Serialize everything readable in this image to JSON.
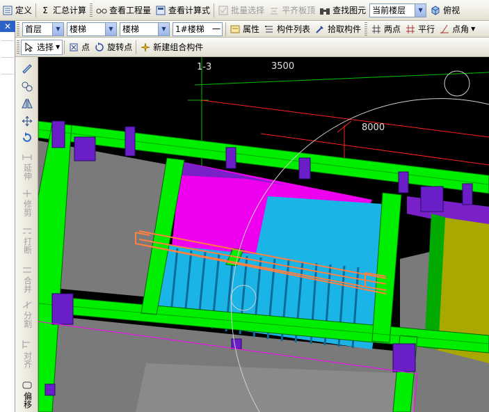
{
  "toolbar1": {
    "define_label": "定义",
    "summary_label": "汇总计算",
    "view_qty_label": "查看工程量",
    "view_formula_label": "查看计算式",
    "batch_select_label": "批量选择",
    "level_top_label": "平齐板顶",
    "find_element_label": "查找图元",
    "floor_scope_value": "当前楼层",
    "view_label": "俯视"
  },
  "toolbar2": {
    "floor_value": "首层",
    "category_value": "楼梯",
    "type_value": "楼梯",
    "element_value": "1#楼梯",
    "element_extra": "一",
    "properties_label": "属性",
    "component_list_label": "构件列表",
    "pick_component_label": "拾取构件",
    "two_point_label": "两点",
    "parallel_label": "平行",
    "point_angle_label": "点角"
  },
  "toolbar3": {
    "select_label": "选择",
    "point_label": "点",
    "rotate_point_label": "旋转点",
    "new_group_label": "新建组合构件"
  },
  "left_tools": {
    "extend_label": "延伸",
    "trim_label": "修剪",
    "break_label": "打断",
    "merge_label": "合并",
    "split_label": "分割",
    "align_label": "对齐",
    "offset_label": "偏移"
  },
  "canvas": {
    "axis_label": "1-3",
    "dim_top": "3500",
    "dim_mid": "8000"
  },
  "colors": {
    "beam_green": "#00ee00",
    "column_purple": "#6a1ec8",
    "slab_magenta": "#ee00ee",
    "stair_blue": "#1ab4e6",
    "wall_olive": "#a8a800",
    "rebar_orange": "#ff8040",
    "slab_gray": "#7a7a7a"
  }
}
